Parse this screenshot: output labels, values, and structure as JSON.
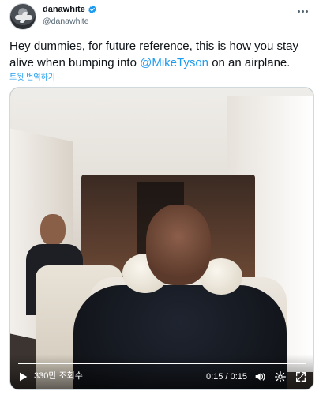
{
  "user": {
    "display_name": "danawhite",
    "handle": "@danawhite",
    "verified": true
  },
  "tweet": {
    "text_before": "Hey dummies, for future reference, this is how you stay alive when bumping into ",
    "mention": "@MikeTyson",
    "text_after": " on an airplane.",
    "translate_label": "트윗 번역하기"
  },
  "video": {
    "views_label": "330만 조회수",
    "time_label": "0:15 / 0:15",
    "progress": 1.0
  },
  "colors": {
    "accent": "#1d9bf0",
    "text": "#0f1419",
    "muted": "#536471"
  },
  "icons": {
    "verified": "verified-badge-icon",
    "more": "more-icon",
    "play": "play-icon",
    "volume": "volume-icon",
    "settings": "settings-icon",
    "fullscreen": "fullscreen-icon"
  }
}
